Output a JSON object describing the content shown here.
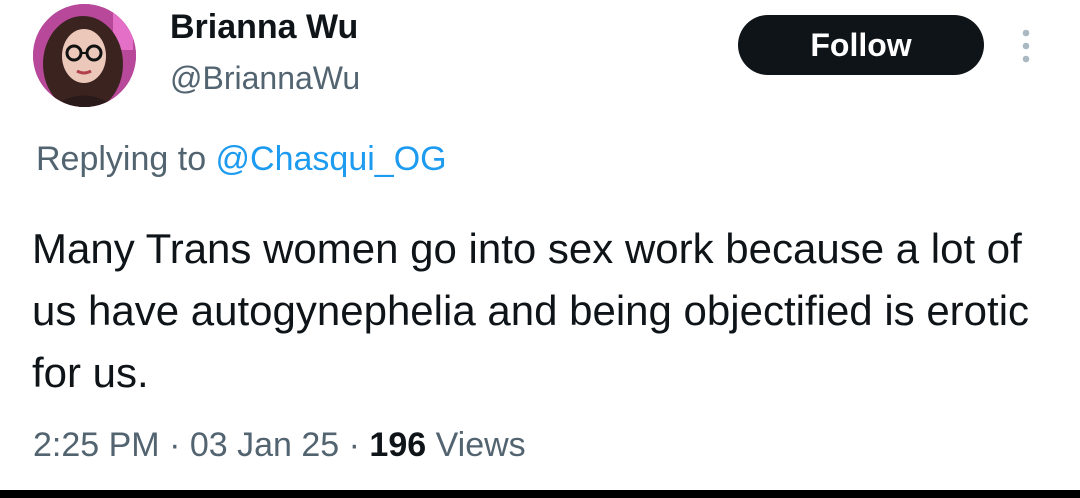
{
  "author": {
    "display_name": "Brianna Wu",
    "handle": "@BriannaWu"
  },
  "actions": {
    "follow_label": "Follow",
    "more_icon": "more-vertical-icon"
  },
  "reply_context": {
    "prefix": "Replying to ",
    "mention": "@Chasqui_OG"
  },
  "tweet": {
    "text": "Many Trans women go into sex work because a lot of us have autogynephelia and being objectified is erotic for us."
  },
  "meta": {
    "time": "2:25 PM",
    "separator": " · ",
    "date": "03 Jan 25",
    "views_count": "196",
    "views_label": " Views"
  },
  "colors": {
    "text_primary": "#0f1419",
    "text_secondary": "#536471",
    "mention": "#1d9bf0",
    "follow_bg": "#0f1419"
  }
}
